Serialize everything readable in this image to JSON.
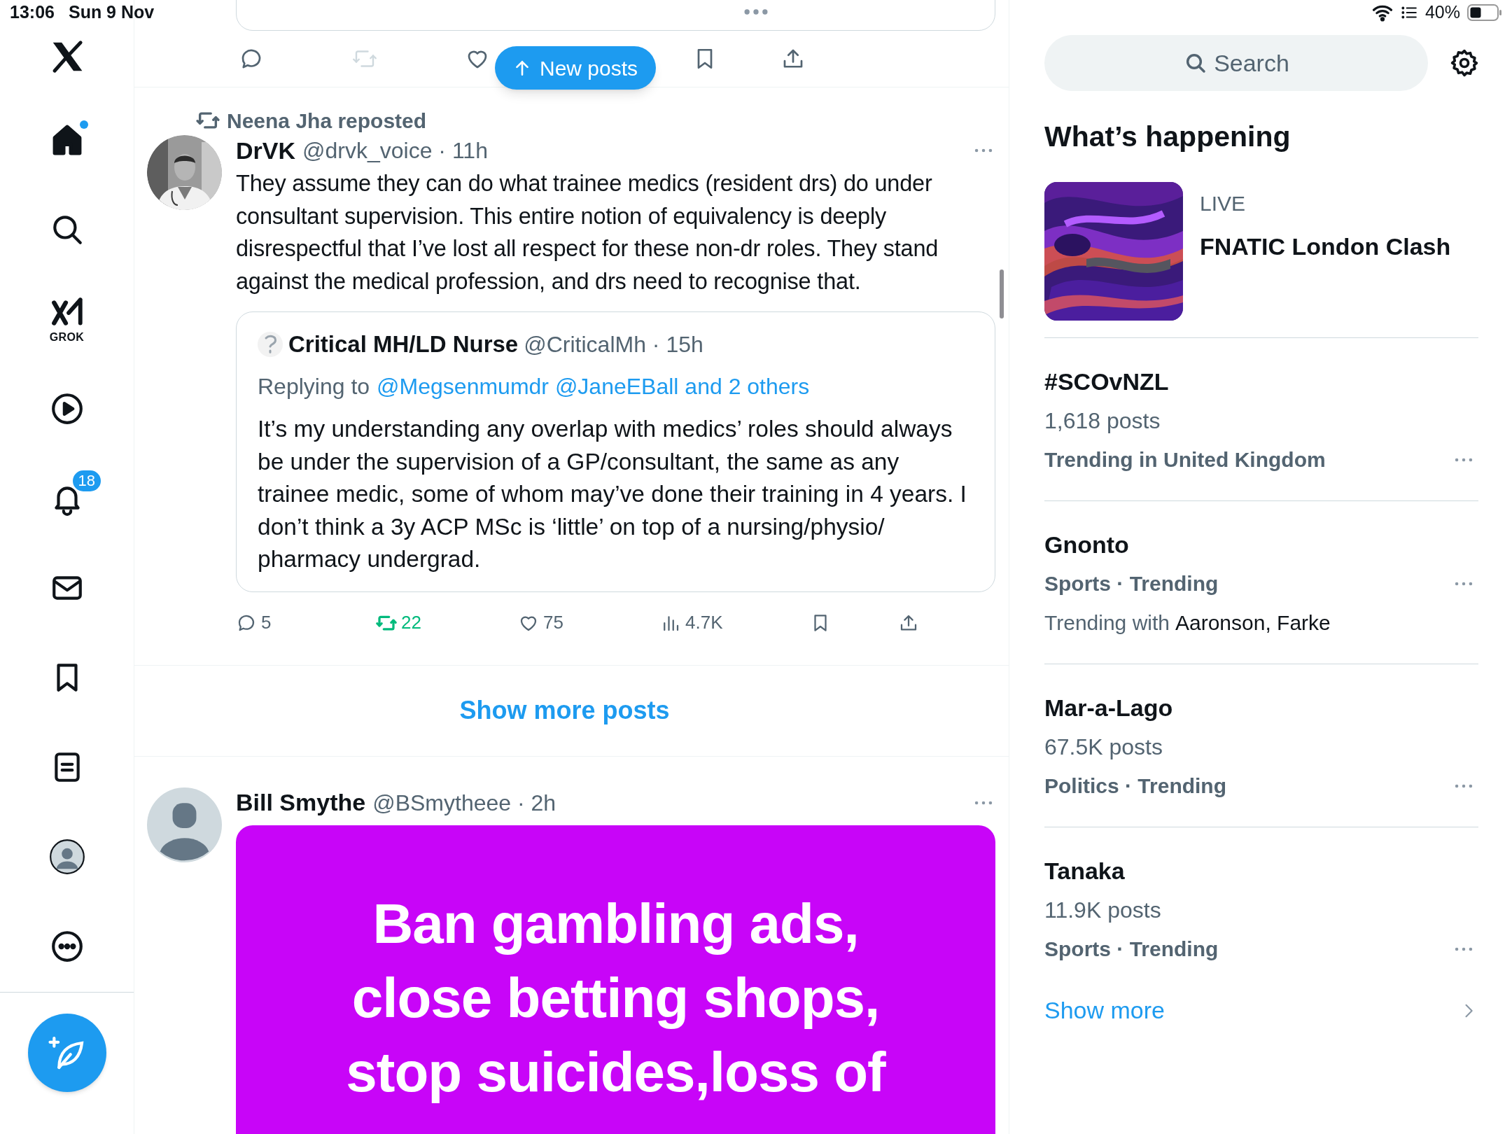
{
  "status_bar": {
    "time": "13:06",
    "date": "Sun 9 Nov",
    "battery_percent": "40%"
  },
  "nav": {
    "items": [
      {
        "kind": "logo"
      },
      {
        "kind": "home",
        "selected": true,
        "unread_dot": true
      },
      {
        "kind": "search",
        "selected": false
      },
      {
        "kind": "grok",
        "label": "GROK",
        "selected": false
      },
      {
        "kind": "video",
        "selected": false
      },
      {
        "kind": "notifications",
        "badge": "18",
        "selected": false
      },
      {
        "kind": "messages",
        "selected": false
      },
      {
        "kind": "bookmarks",
        "selected": false
      },
      {
        "kind": "lists",
        "selected": false
      },
      {
        "kind": "profile",
        "selected": false
      },
      {
        "kind": "more",
        "selected": false
      }
    ]
  },
  "feed": {
    "top_fragment": {
      "actions": [
        {
          "kind": "reply",
          "disabled": false
        },
        {
          "kind": "repost",
          "disabled": true
        },
        {
          "kind": "like",
          "disabled": false
        },
        {
          "kind": "bookmark",
          "disabled": false
        },
        {
          "kind": "share",
          "disabled": false
        }
      ]
    },
    "new_posts_button": "New posts",
    "post": {
      "reposted_by": "Neena Jha reposted",
      "author": "DrVK",
      "meta": "@drvk_voice · 11h",
      "text": "They assume they can do what trainee medics (resident drs) do under consultant supervision. This entire notion of equivalency is deeply disrespectful that I’ve lost all respect for these non-dr roles. They stand against the medical profession, and drs need to recognise that.",
      "quote": {
        "author": "Critical MH/LD Nurse",
        "meta": "@CriticalMh · 15h",
        "replying_label": "Replying to",
        "replying_to": "@Megsenmumdr @JaneEBall and 2 others",
        "text": "It’s my understanding any overlap with medics’ roles should always be under the supervision of a GP/consultant, the same as any trainee medic, some of whom may’ve done their training in 4 years. I don’t think a 3y ACP MSc is ‘little’ on top of a nursing/physio/ pharmacy undergrad."
      },
      "actions": [
        {
          "kind": "reply",
          "count": "5",
          "selected": false
        },
        {
          "kind": "repost",
          "count": "22",
          "selected": true
        },
        {
          "kind": "like",
          "count": "75",
          "selected": false
        },
        {
          "kind": "views",
          "count": "4.7K",
          "selected": false
        },
        {
          "kind": "bookmark",
          "selected": false
        },
        {
          "kind": "share",
          "selected": false
        }
      ]
    },
    "show_more": "Show more posts",
    "post2": {
      "author": "Bill Smythe",
      "meta": "@BSmytheee · 2h",
      "media_text": "Ban gambling ads, close betting shops, stop suicides,loss of"
    }
  },
  "sidebar": {
    "search": {
      "placeholder": "Search"
    },
    "heading": "What’s happening",
    "live": {
      "label": "LIVE",
      "title": "FNATIC London Clash"
    },
    "trends": [
      {
        "name": "#SCOvNZL",
        "posts": "1,618 posts",
        "category": "Trending in United Kingdom"
      },
      {
        "name": "Gnonto",
        "category": "Sports · Trending",
        "trending_with_label": "Trending with",
        "trending_with": "Aaronson, Farke"
      },
      {
        "name": "Mar-a-Lago",
        "posts": "67.5K posts",
        "category": "Politics · Trending"
      },
      {
        "name": "Tanaka",
        "posts": "11.9K posts",
        "category": "Sports · Trending"
      }
    ],
    "show_more": "Show more"
  }
}
